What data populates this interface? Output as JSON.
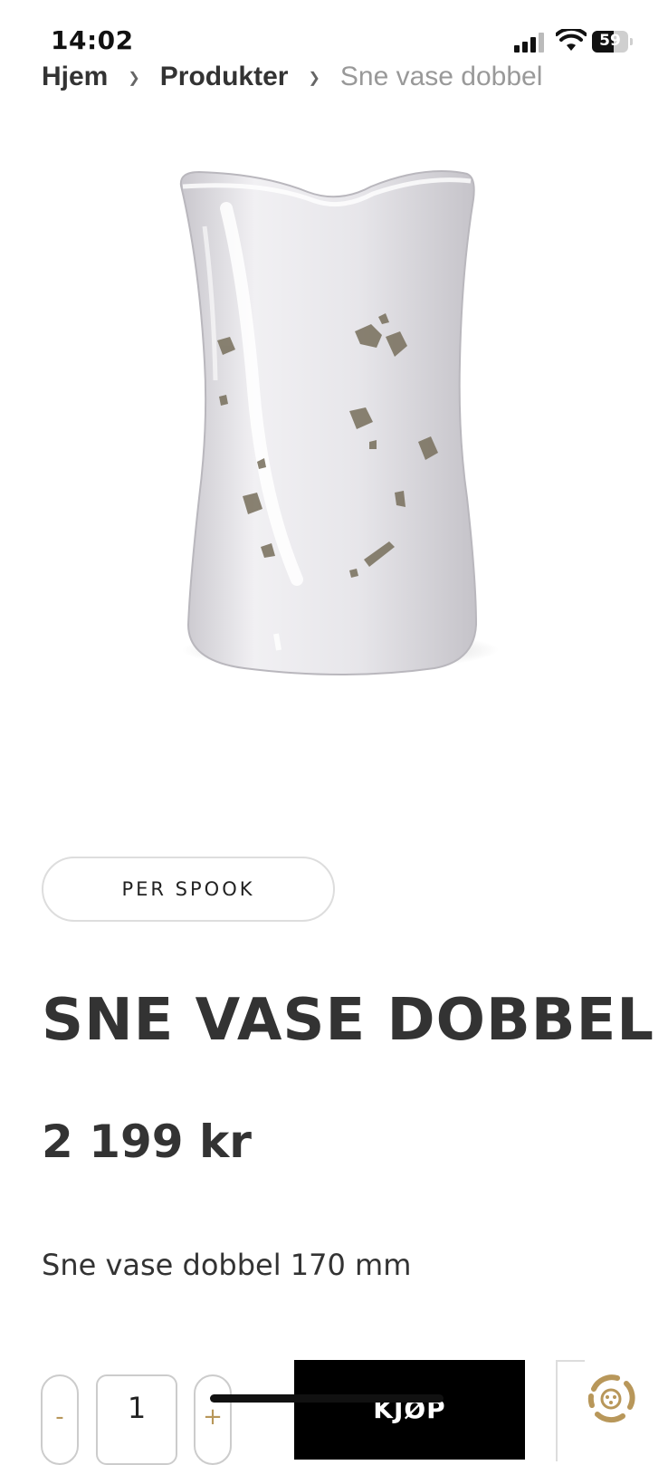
{
  "status_bar": {
    "time": "14:02",
    "battery": "59",
    "battery_level": 0.59
  },
  "breadcrumb": [
    {
      "label": "Hjem"
    },
    {
      "label": "Produkter"
    },
    {
      "label": "Sne vase dobbel"
    }
  ],
  "product": {
    "brand": "PER SPOOK",
    "title": "SNE VASE DOBBEL",
    "price": "2 199 kr",
    "description": "Sne vase dobbel 170 mm"
  },
  "purchase": {
    "qty_minus": "-",
    "quantity": "1",
    "qty_plus": "+",
    "buy_label": "KJØP"
  },
  "icons": {
    "signal": "signal-icon",
    "wifi": "wifi-icon",
    "battery": "battery-icon",
    "chat": "chat-widget-icon"
  },
  "colors": {
    "accent": "#b8975a",
    "button": "#000000"
  }
}
